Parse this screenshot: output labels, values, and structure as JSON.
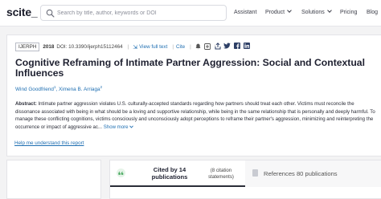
{
  "header": {
    "logo": "scite_",
    "search_placeholder": "Search by title, author, keywords or DOI",
    "nav": [
      {
        "label": "Assistant"
      },
      {
        "label": "Product"
      },
      {
        "label": "Solutions"
      },
      {
        "label": "Pricing"
      },
      {
        "label": "Blog"
      }
    ]
  },
  "article": {
    "journal": "IJERPH",
    "year": "2018",
    "doi": "DOI: 10.3390/ijerph15112464",
    "view_full_text": "View full text",
    "cite": "Cite",
    "title": "Cognitive Reframing of Intimate Partner Aggression: Social and Contextual Influences",
    "authors": [
      {
        "name": "Wind Goodfriend",
        "sup": "1"
      },
      {
        "name": "Ximena B. Arriaga",
        "sup": "2"
      }
    ],
    "abstract_label": "Abstract:",
    "abstract_text": " Intimate partner aggression violates U.S. culturally-accepted standards regarding how partners should treat each other. Victims must reconcile the dissonance associated with being in what should be a loving and supportive relationship, while being in the same relationship that is personally and deeply harmful. To manage these conflicting cognitions, victims consciously and unconsciously adopt perceptions to reframe their partner's aggression, minimizing and reinterpreting the occurrence or impact of aggressive ac...",
    "show_more": "Show more",
    "help_link": "Help me understand this report"
  },
  "tabs": {
    "cited_by": "Cited by 14 publications",
    "citation_statements": "(8 citation statements)",
    "references": "References 80 publications"
  },
  "colors": {
    "link": "#1f6fb2",
    "accent_green": "#3fa357"
  }
}
